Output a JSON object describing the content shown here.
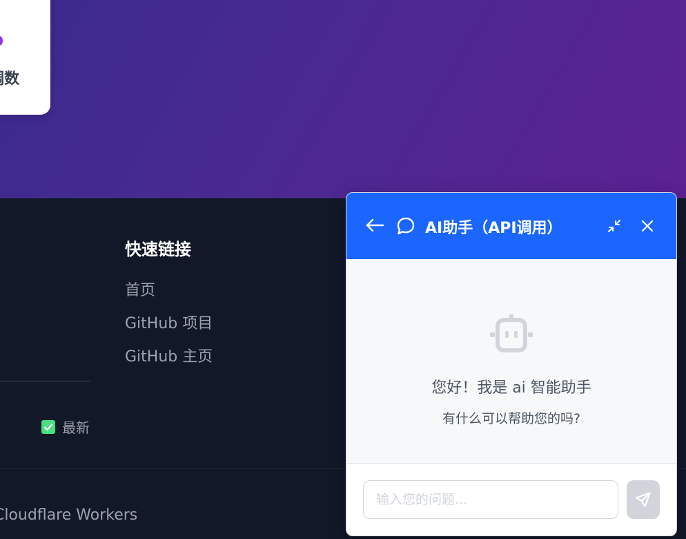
{
  "hero": {
    "stat_label": "调数"
  },
  "footer": {
    "quick_links_title": "快速链接",
    "links": [
      "首页",
      "GitHub 项目",
      "GitHub 主页"
    ],
    "badge_label": "最新",
    "powered_by": "Cloudflare Workers"
  },
  "chat": {
    "title": "AI助手（API调用）",
    "welcome_title": "您好！我是 ai 智能助手",
    "welcome_sub": "有什么可以帮助您的吗?",
    "input_placeholder": "输入您的问题...",
    "input_value": ""
  },
  "colors": {
    "hero_gradient_start": "#3b2b8e",
    "hero_gradient_end": "#5b2192",
    "footer_bg": "#111827",
    "chat_header": "#1a66ff",
    "chat_body": "#f7f8fa",
    "check_green": "#4ade80"
  },
  "icons": {
    "back": "arrow-left-icon",
    "chat": "chat-bubble-icon",
    "minimize": "minimize-icon",
    "close": "close-icon",
    "robot": "robot-icon",
    "send": "send-icon",
    "check": "checkbox-checked-icon"
  }
}
